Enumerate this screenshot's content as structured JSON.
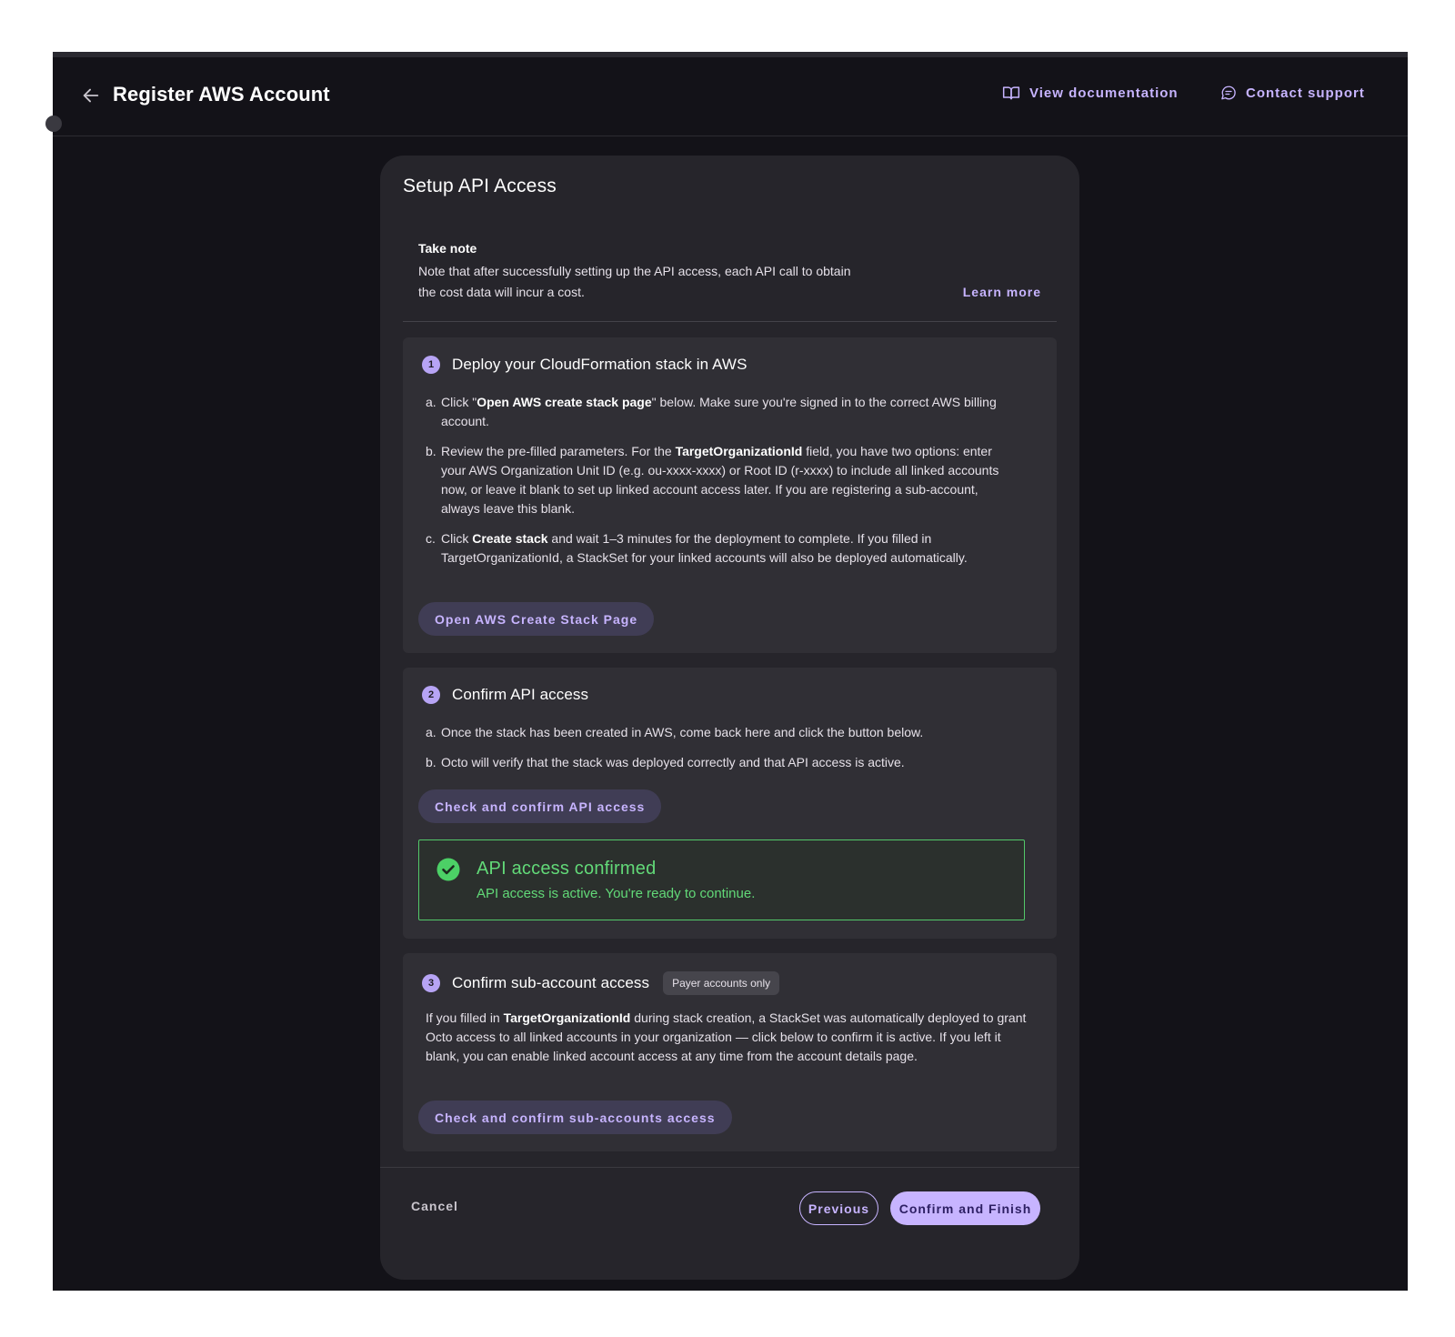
{
  "header": {
    "title": "Register AWS Account",
    "back_icon": "arrow-left-icon",
    "links": [
      {
        "label": "View documentation",
        "icon": "book-icon"
      },
      {
        "label": "Contact support",
        "icon": "chat-bubble-icon"
      }
    ]
  },
  "card": {
    "title": "Setup API Access",
    "note": {
      "heading": "Take note",
      "text": "Note that after successfully setting up the API access, each API call to obtain the cost data will incur a cost.",
      "link": "Learn more"
    },
    "steps": [
      {
        "number": "1",
        "title": "Deploy your CloudFormation stack in AWS",
        "items": [
          {
            "marker": "a.",
            "parts": [
              "Click \"",
              "Open AWS create stack page",
              "\" below. Make sure you're signed in to the correct AWS billing account."
            ]
          },
          {
            "marker": "b.",
            "parts": [
              "Review the pre-filled parameters. For the ",
              "TargetOrganizationId",
              " field, you have two options: enter your AWS Organization Unit ID (e.g. ou-xxxx-xxxx) or Root ID (r-xxxx) to include all linked accounts now, or leave it blank to set up linked account access later. If you are registering a sub-account, always leave this blank."
            ]
          },
          {
            "marker": "c.",
            "parts": [
              "Click ",
              "Create stack",
              " and wait 1–3 minutes for the deployment to complete. If you filled in TargetOrganizationId, a StackSet for your linked accounts will also be deployed automatically."
            ]
          }
        ],
        "button": "Open AWS Create Stack Page"
      },
      {
        "number": "2",
        "title": "Confirm API access",
        "items": [
          {
            "marker": "a.",
            "text": "Once the stack has been created in AWS, come back here and click the button below."
          },
          {
            "marker": "b.",
            "text": "Octo will verify that the stack was deployed correctly and that API access is active."
          }
        ],
        "button": "Check and confirm API access",
        "success": {
          "icon": "check-circle-icon",
          "title": "API access confirmed",
          "message": "API access is active. You're ready to continue."
        }
      },
      {
        "number": "3",
        "title": "Confirm sub-account access",
        "badge": "Payer accounts only",
        "parts": [
          "If you filled in ",
          "TargetOrganizationId",
          " during stack creation, a StackSet was automatically deployed to grant Octo access to all linked accounts in your organization — click below to confirm it is active. If you left it blank, you can enable linked account access at any time from the account details page."
        ],
        "button": "Check and confirm sub-accounts access"
      }
    ]
  },
  "footer": {
    "cancel": "Cancel",
    "previous": "Previous",
    "finish": "Confirm and Finish"
  },
  "colors": {
    "background": "#131218",
    "card": "#26252b",
    "step_panel": "#302f35",
    "accent": "#c7b4ff",
    "success": "#62d978"
  }
}
